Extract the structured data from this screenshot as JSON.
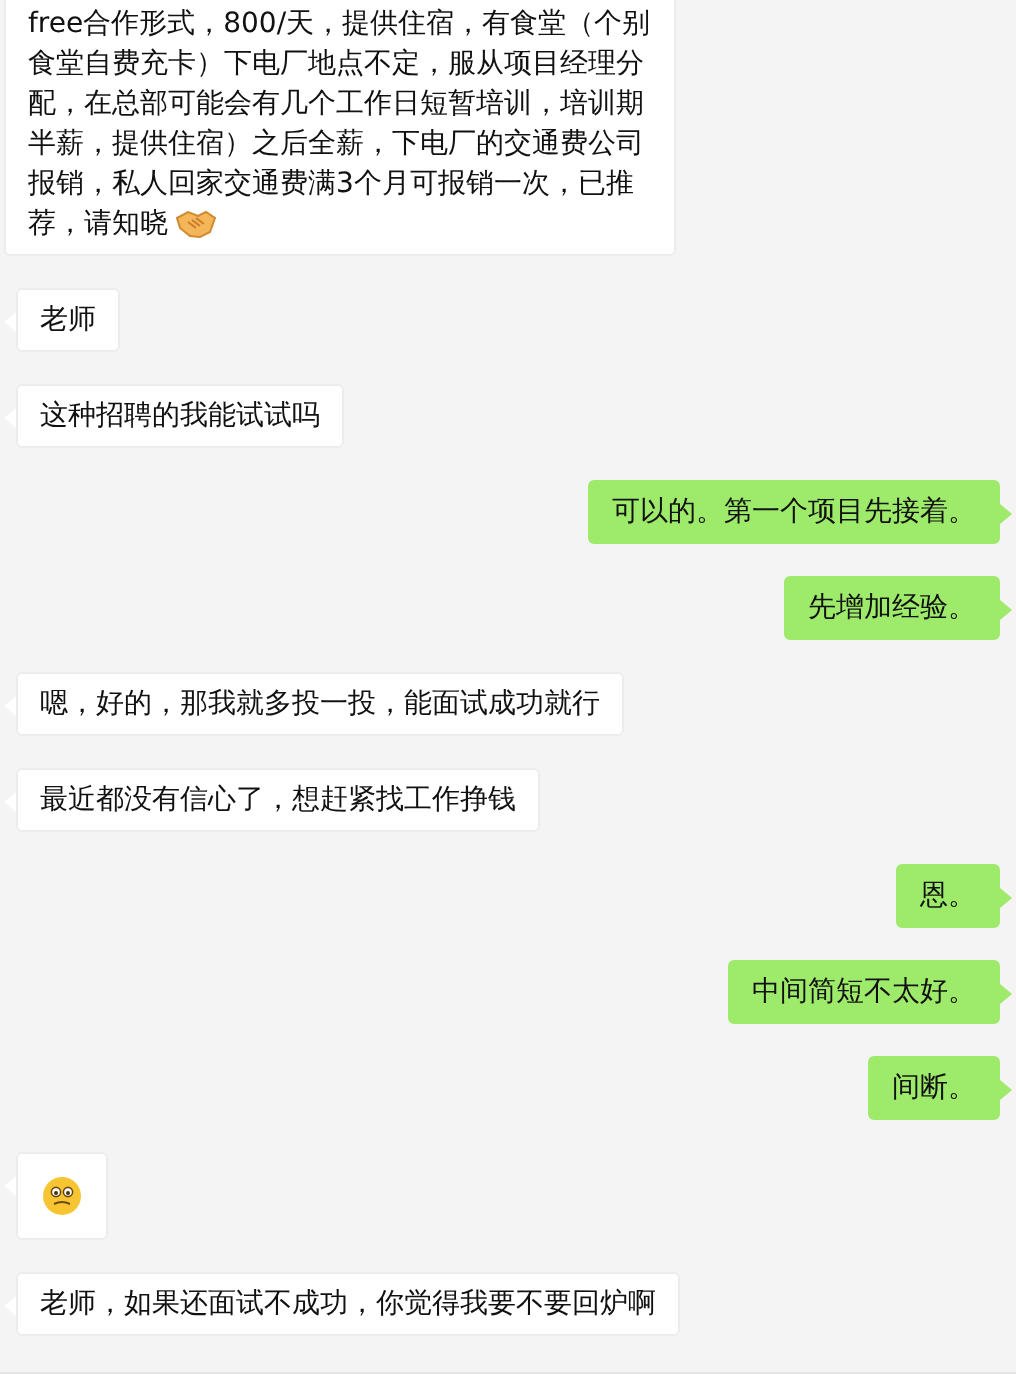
{
  "messages": [
    {
      "outgoing": false,
      "kind": "text",
      "text": "free合作形式，800/天，提供住宿，有食堂（个别食堂自费充卡）下电厂地点不定，服从项目经理分配，在总部可能会有几个工作日短暂培训，培训期半薪，提供住宿）之后全薪，下电厂的交通费公司报销，私人回家交通费满3个月可报销一次，已推荐，请知晓",
      "emoji_after": true
    },
    {
      "outgoing": false,
      "kind": "text",
      "text": "老师"
    },
    {
      "outgoing": false,
      "kind": "text",
      "text": "这种招聘的我能试试吗"
    },
    {
      "outgoing": true,
      "kind": "text",
      "text": "可以的。第一个项目先接着。"
    },
    {
      "outgoing": true,
      "kind": "text",
      "text": "先增加经验。"
    },
    {
      "outgoing": false,
      "kind": "text",
      "text": "嗯，好的，那我就多投一投，能面试成功就行"
    },
    {
      "outgoing": false,
      "kind": "text",
      "text": "最近都没有信心了，想赶紧找工作挣钱"
    },
    {
      "outgoing": true,
      "kind": "text",
      "text": "恩。"
    },
    {
      "outgoing": true,
      "kind": "text",
      "text": "中间简短不太好。"
    },
    {
      "outgoing": true,
      "kind": "text",
      "text": "间断。"
    },
    {
      "outgoing": false,
      "kind": "emoji"
    },
    {
      "outgoing": false,
      "kind": "text",
      "text": "老师，如果还面试不成功，你觉得我要不要回炉啊"
    }
  ]
}
